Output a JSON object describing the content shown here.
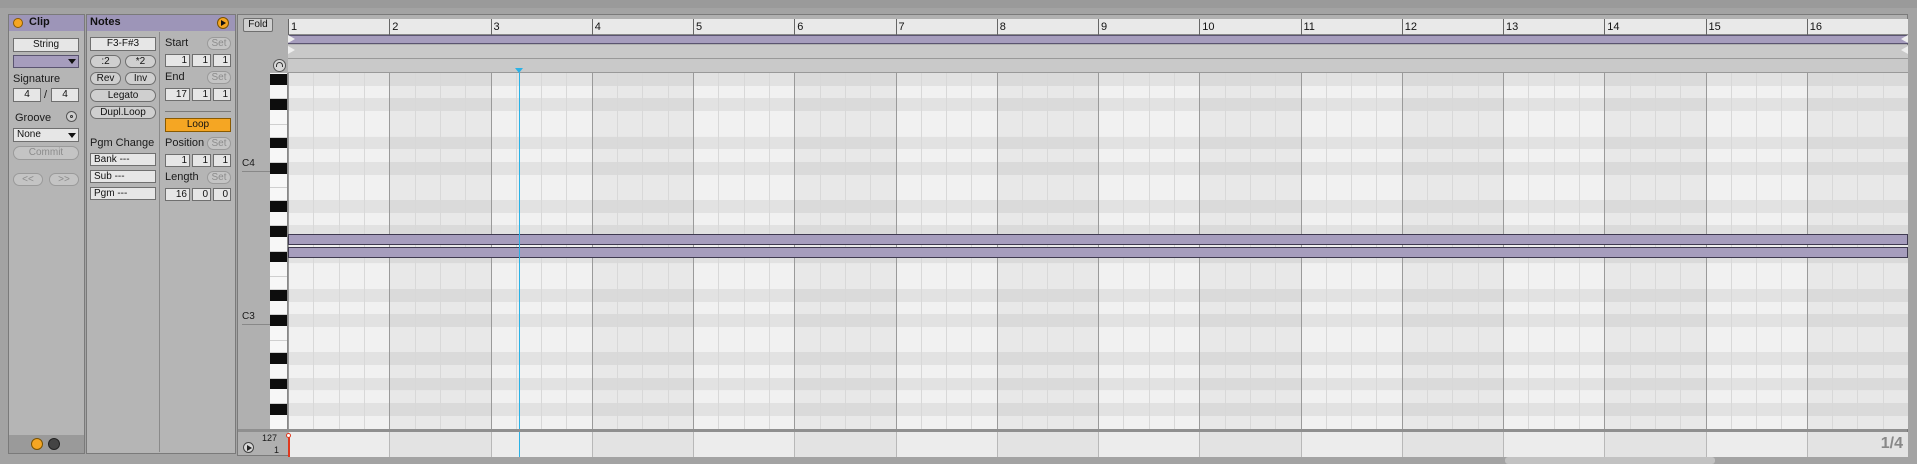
{
  "clip": {
    "header_label": "Clip",
    "name_field": "String",
    "signature_label": "Signature",
    "sig_num": "4",
    "sig_slash": "/",
    "sig_den": "4",
    "groove_label": "Groove",
    "groove_value": "None",
    "commit_label": "Commit",
    "prev_label": "<<",
    "next_label": ">>",
    "color": "#a69dbd"
  },
  "notes": {
    "header_label": "Notes",
    "range_field": "F3-F#3",
    "half_label": ":2",
    "double_label": "*2",
    "rev_label": "Rev",
    "inv_label": "Inv",
    "legato_label": "Legato",
    "dupl_label": "Dupl.Loop",
    "pgm_change_label": "Pgm Change",
    "bank_field": "Bank ---",
    "sub_field": "Sub ---",
    "pgm_field": "Pgm ---",
    "start_label": "Start",
    "start_set": "Set",
    "start_vals": [
      "1",
      "1",
      "1"
    ],
    "end_label": "End",
    "end_set": "Set",
    "end_vals": [
      "17",
      "1",
      "1"
    ],
    "loop_label": "Loop",
    "position_label": "Position",
    "position_set": "Set",
    "position_vals": [
      "1",
      "1",
      "1"
    ],
    "length_label": "Length",
    "length_set": "Set",
    "length_vals": [
      "16",
      "0",
      "0"
    ],
    "loop_color": "#f5a623"
  },
  "editor": {
    "fold_label": "Fold",
    "bars": [
      "1",
      "2",
      "3",
      "4",
      "5",
      "6",
      "7",
      "8",
      "9",
      "10",
      "11",
      "12",
      "13",
      "14",
      "15",
      "16"
    ],
    "key_labels": [
      "C4",
      "C3"
    ],
    "velocity_max": "127",
    "velocity_min": "1",
    "grid_label": "1/4",
    "playhead_color": "#2bb2e6",
    "note_color": "#a69dbd"
  }
}
